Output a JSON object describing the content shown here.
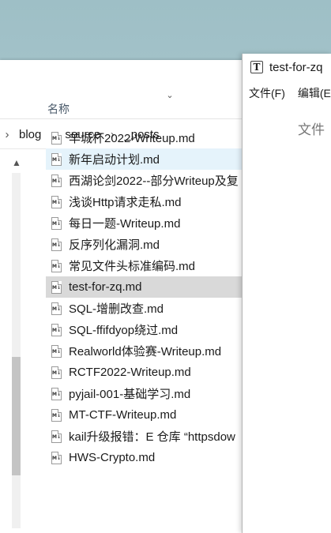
{
  "breadcrumb": [
    "blog",
    "source",
    "_posts"
  ],
  "column_header": "名称",
  "files": [
    {
      "name": "羊城杯2022-Writeup.md",
      "state": "normal"
    },
    {
      "name": "新年启动计划.md",
      "state": "hover"
    },
    {
      "name": "西湖论剑2022--部分Writeup及复",
      "state": "normal"
    },
    {
      "name": "浅谈Http请求走私.md",
      "state": "normal"
    },
    {
      "name": "每日一题-Writeup.md",
      "state": "normal"
    },
    {
      "name": "反序列化漏洞.md",
      "state": "normal"
    },
    {
      "name": "常见文件头标准编码.md",
      "state": "normal"
    },
    {
      "name": "test-for-zq.md",
      "state": "selected"
    },
    {
      "name": "SQL-增删改查.md",
      "state": "normal"
    },
    {
      "name": "SQL-ffifdyop绕过.md",
      "state": "normal"
    },
    {
      "name": "Realworld体验赛-Writeup.md",
      "state": "normal"
    },
    {
      "name": "RCTF2022-Writeup.md",
      "state": "normal"
    },
    {
      "name": "pyjail-001-基础学习.md",
      "state": "normal"
    },
    {
      "name": "MT-CTF-Writeup.md",
      "state": "normal"
    },
    {
      "name": "kail升级报错：E 仓库 “httpsdow",
      "state": "normal"
    },
    {
      "name": "HWS-Crypto.md",
      "state": "normal"
    }
  ],
  "typora": {
    "logo": "T",
    "title": "test-for-zq",
    "menu": [
      "文件(F)",
      "编辑(E"
    ],
    "file_tab": "文件"
  },
  "icons": {
    "chevron": "chevron-right-icon",
    "file": "markdown-file-icon"
  },
  "colors": {
    "hover": "#e5f3fb",
    "selected": "#d9d9d9",
    "desktop": "#a9c4cc"
  }
}
